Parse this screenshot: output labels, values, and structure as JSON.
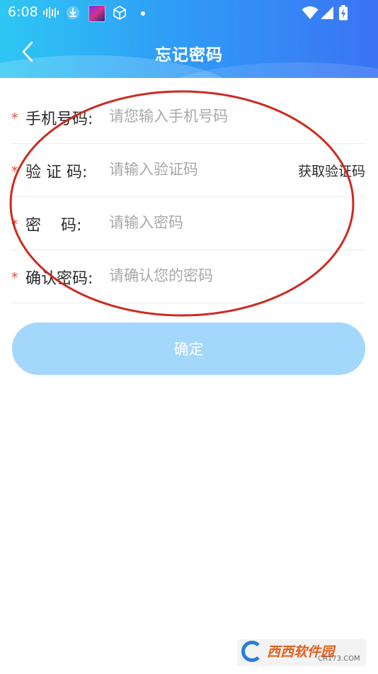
{
  "status_bar": {
    "time": "6:08"
  },
  "header": {
    "title": "忘记密码"
  },
  "form": {
    "rows": [
      {
        "label": "手机号码:",
        "placeholder": "请您输入手机号码"
      },
      {
        "label": "验 证 码:",
        "placeholder": "请输入验证码",
        "action": "获取验证码"
      },
      {
        "label": "密    码:",
        "placeholder": "请输入密码"
      },
      {
        "label": "确认密码:",
        "placeholder": "请确认您的密码"
      }
    ],
    "required_mark": "*"
  },
  "confirm_button": {
    "label": "确定"
  },
  "watermark": {
    "text": "西西软件园",
    "subtext": "CR173.COM"
  },
  "colors": {
    "accent": "#2f9df6",
    "required": "#e04a3a",
    "button_disabled": "#a3d7fb",
    "annotation": "#cc2a1f"
  }
}
